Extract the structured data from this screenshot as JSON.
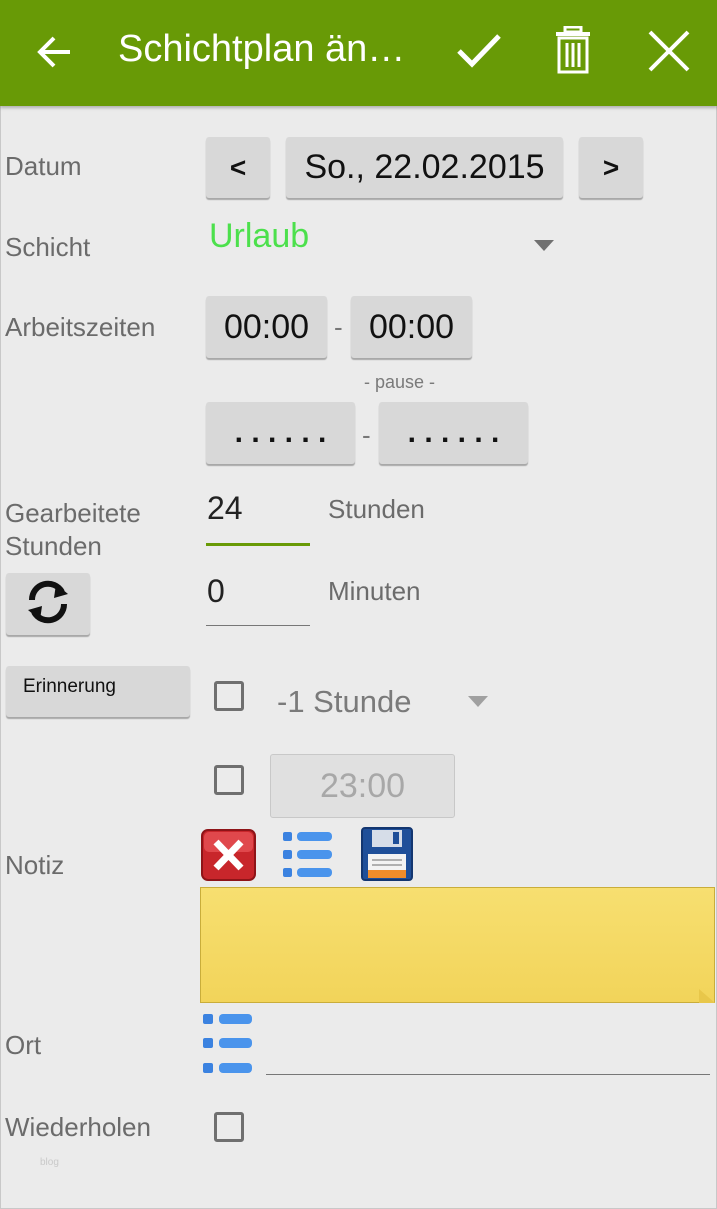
{
  "appbar": {
    "title": "Schichtplan än…",
    "icons": {
      "back": "arrow-left-icon",
      "confirm": "check-icon",
      "delete": "trash-icon",
      "close": "close-icon"
    },
    "background_color": "#689a06"
  },
  "date": {
    "label": "Datum",
    "prev_label": "<",
    "value": "So., 22.02.2015",
    "next_label": ">"
  },
  "shift": {
    "label": "Schicht",
    "value": "Urlaub",
    "value_color": "#4ce04c"
  },
  "work_times": {
    "label": "Arbeitszeiten",
    "start": "00:00",
    "separator": "-",
    "end": "00:00",
    "pause_label": "- pause -",
    "pause_start": ". . . . . .",
    "pause_separator": "-",
    "pause_end": ". . . . . ."
  },
  "worked": {
    "label": "Gearbeitete Stunden",
    "hours_value": "24",
    "hours_unit": "Stunden",
    "minutes_value": "0",
    "minutes_unit": "Minuten",
    "refresh_icon": "refresh-icon"
  },
  "reminder": {
    "button_label": "Erinnerung",
    "offset_value": "-1 Stunde",
    "time_value": "23:00"
  },
  "note": {
    "label": "Notiz",
    "icons": [
      "delete-red-x-icon",
      "list-icon",
      "floppy-save-icon"
    ],
    "note_color": "#f6dc6e"
  },
  "location": {
    "label": "Ort",
    "list_icon": "list-icon"
  },
  "repeat": {
    "label": "Wiederholen"
  },
  "footer": {
    "watermark": "blog"
  }
}
